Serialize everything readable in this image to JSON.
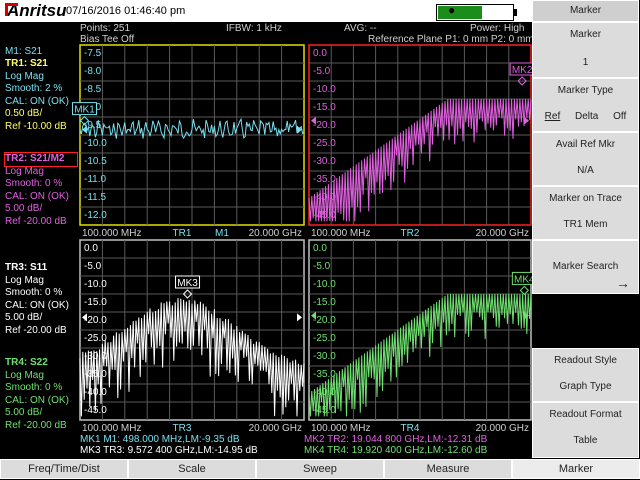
{
  "brand": "Anritsu",
  "datetime": "07/16/2016 01:46:40 pm",
  "header": {
    "points": "Points: 251",
    "bias_tee": "Bias Tee Off",
    "ifbw": "IFBW: 1 kHz",
    "avg": "AVG: --",
    "power": "Power: High",
    "ref_plane": "Reference Plane P1: 0 mm P2: 0 mm"
  },
  "traces": {
    "m1": "M1: S21",
    "tr1": {
      "title": "TR1: S21",
      "fmt": "Log Mag",
      "smooth": "Smooth: 2 %",
      "cal": "CAL: ON (OK)",
      "scale": "0.50 dB/",
      "ref": "Ref -10.00 dB",
      "color": "#78e0ee"
    },
    "tr2": {
      "title": "TR2: S21/M2",
      "fmt": "Log Mag",
      "smooth": "Smooth: 0 %",
      "cal": "CAL: ON (OK)",
      "scale": "5.00 dB/",
      "ref": "Ref -20.00 dB",
      "color": "#e060e0"
    },
    "tr3": {
      "title": "TR3: S11",
      "fmt": "Log Mag",
      "smooth": "Smooth: 0 %",
      "cal": "CAL: ON (OK)",
      "scale": "5.00 dB/",
      "ref": "Ref -20.00 dB",
      "color": "#ffffff"
    },
    "tr4": {
      "title": "TR4: S22",
      "fmt": "Log Mag",
      "smooth": "Smooth: 0 %",
      "cal": "CAL: ON (OK)",
      "scale": "5.00 dB/",
      "ref": "Ref -20.00 dB",
      "color": "#70e070"
    }
  },
  "graphs": {
    "g1": {
      "yticks": [
        "-7.5",
        "-8.0",
        "-8.5",
        "-9.0",
        "-9.5",
        "-10.0",
        "-10.5",
        "-11.0",
        "-11.5",
        "-12.0"
      ],
      "start": "100.000 MHz",
      "name": "TR1",
      "memo": "M1",
      "stop": "20.000 GHz",
      "marker": "MK1"
    },
    "g2": {
      "yticks": [
        "0.0",
        "-5.0",
        "-10.0",
        "-15.0",
        "-20.0",
        "-25.0",
        "-30.0",
        "-35.0",
        "-40.0",
        "-45.0"
      ],
      "start": "100.000 MHz",
      "name": "TR2",
      "stop": "20.000 GHz",
      "marker": "MK2"
    },
    "g3": {
      "yticks": [
        "0.0",
        "-5.0",
        "-10.0",
        "-15.0",
        "-20.0",
        "-25.0",
        "-30.0",
        "-35.0",
        "-40.0",
        "-45.0"
      ],
      "start": "100.000 MHz",
      "name": "TR3",
      "stop": "20.000 GHz",
      "marker": "MK3"
    },
    "g4": {
      "yticks": [
        "0.0",
        "-5.0",
        "-10.0",
        "-15.0",
        "-20.0",
        "-25.0",
        "-30.0",
        "-35.0",
        "-40.0",
        "-45.0"
      ],
      "start": "100.000 MHz",
      "name": "TR4",
      "stop": "20.000 GHz",
      "marker": "MK4"
    }
  },
  "readouts": {
    "mk1": "MK1 M1:  498.000 MHz,LM:-9.35 dB",
    "mk3": "MK3 TR3:  9.572 400 GHz,LM:-14.95 dB",
    "mk2": "MK2 TR2:  19.044 800 GHz,LM:-12.31 dB",
    "mk4": "MK4 TR4:  19.920 400 GHz,LM:-12.60 dB"
  },
  "softkeys": {
    "title": "Marker",
    "k1": {
      "l1": "Marker",
      "l2": "1"
    },
    "k2": {
      "l1": "Marker Type",
      "a": "Ref",
      "b": "Delta",
      "c": "Off"
    },
    "k3": {
      "l1": "Avail Ref Mkr",
      "l2": "N/A"
    },
    "k4": {
      "l1": "Marker on Trace",
      "l2": "TR1 Mem"
    },
    "k5": {
      "l1": "Marker Search",
      "l2": "→"
    },
    "k6": {
      "l1": "Readout Style",
      "l2": "Graph Type"
    },
    "k7": {
      "l1": "Readout Format",
      "l2": "Table"
    }
  },
  "bottom": [
    "Freq/Time/Dist",
    "Scale",
    "Sweep",
    "Measure",
    "Marker"
  ],
  "colors": {
    "grid": "#bfbfbf",
    "gridline": "#555555",
    "active_border": "#ff2020",
    "tr1_border": "#e0e000"
  }
}
